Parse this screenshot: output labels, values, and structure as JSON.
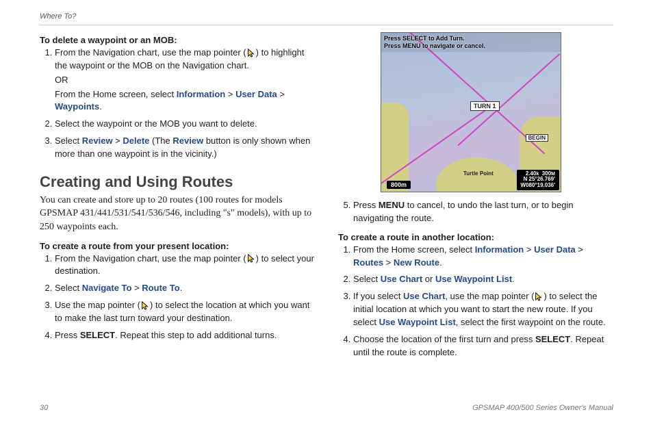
{
  "header": "Where To?",
  "footer": {
    "page": "30",
    "title": "GPSMAP 400/500 Series Owner's Manual"
  },
  "left": {
    "h1": "To delete a waypoint or an MOB:",
    "s1a": "From the Navigation chart, use the map pointer (",
    "s1b": ") to highlight the waypoint or the MOB on the Navigation chart.",
    "or": "OR",
    "s1c": "From the Home screen, select ",
    "information": "Information",
    "gt": " > ",
    "userdata": "User Data",
    "waypoints": "Waypoints",
    "period": ".",
    "s2": "Select the waypoint or the MOB you want to delete.",
    "s3a": "Select ",
    "review": "Review",
    "delete": "Delete",
    "s3b": " (The ",
    "s3c": " button is only shown when more than one waypoint is in the vicinity.)",
    "h2": "Creating and Using Routes",
    "intro": "You can create and store up to 20 routes (100 routes for models GPSMAP 431/441/531/541/536/546, including \"s\" models), with up to 250 waypoints each.",
    "h3": "To create a route from your present location:",
    "t1a": "From the Navigation chart, use the map pointer (",
    "t1b": ") to select your destination.",
    "t2a": "Select ",
    "navto": "Navigate To",
    "routeto": "Route To",
    "t3a": "Use the map pointer (",
    "t3b": ") to select the location at which you want to make the last turn toward your destination.",
    "t4a": "Press ",
    "select": "SELECT",
    "t4b": ". Repeat this step to add additional turns."
  },
  "shot": {
    "line1": "Press SELECT to Add Turn.",
    "line2": "Press MENU to navigate or cancel.",
    "turn": "TURN 1",
    "begin": "BEGIN",
    "turtle": "Turtle Point",
    "scale": "800m",
    "info1": "2.40",
    "info1u": "k",
    "info2": "300",
    "info2u": "M",
    "coord": "N 25°26.769'\nW080°19.036'"
  },
  "right": {
    "s5a": "Press ",
    "menu": "MENU",
    "s5b": " to cancel, to undo the last turn, or to begin navigating the route.",
    "h4": "To create a route in another location:",
    "r1a": "From the Home screen, select ",
    "information": "Information",
    "userdata": "User Data",
    "routes": "Routes",
    "newroute": "New Route",
    "gt": " > ",
    "period": ".",
    "r2a": "Select ",
    "usechart": "Use Chart",
    "or": " or ",
    "usewpl": "Use Waypoint List",
    "r3a": "If you select ",
    "r3b": ", use the map pointer (",
    "r3c": ") to select the initial location at which you want to start the new route. If you select ",
    "r3d": ", select the first waypoint on the route.",
    "r4a": "Choose the location of the first turn and press ",
    "select": "SELECT",
    "r4b": ". Repeat until the route is complete."
  }
}
